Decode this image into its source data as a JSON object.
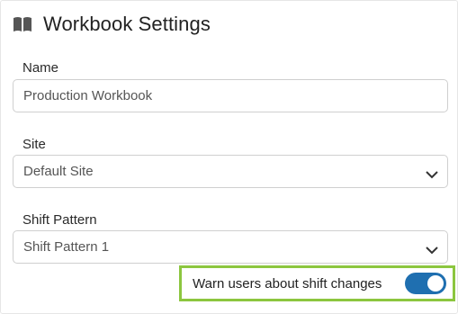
{
  "header": {
    "title": "Workbook Settings",
    "icon": "book-icon"
  },
  "fields": {
    "name": {
      "label": "Name",
      "value": "Production Workbook"
    },
    "site": {
      "label": "Site",
      "selected": "Default Site"
    },
    "shift_pattern": {
      "label": "Shift Pattern",
      "selected": "Shift Pattern 1"
    }
  },
  "warn_toggle": {
    "label": "Warn users about shift changes",
    "enabled": true
  },
  "colors": {
    "toggle_on": "#1f6fb0",
    "highlight_border": "#8cc63f",
    "input_border": "#cfcfcf"
  }
}
